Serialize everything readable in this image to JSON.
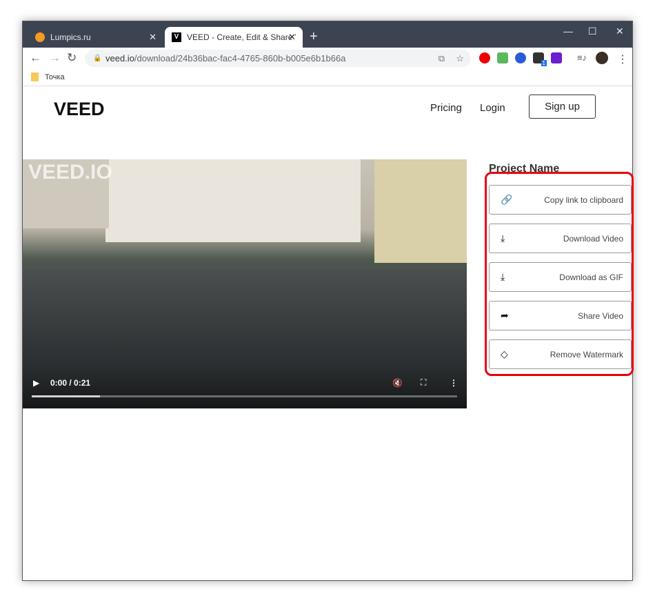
{
  "browser": {
    "tabs": [
      {
        "label": "Lumpics.ru",
        "favicon_color": "#f59a23"
      },
      {
        "label": "VEED - Create, Edit & Share Vide",
        "favicon": "V"
      }
    ],
    "url_host": "veed.io",
    "url_path": "/download/24b36bac-fac4-4765-860b-b005e6b1b66a",
    "bookmarks": [
      "Точка"
    ],
    "extension_badge": "1"
  },
  "site": {
    "logo": "VEED",
    "nav": [
      "Pricing",
      "Login"
    ],
    "signup": "Sign up"
  },
  "video": {
    "watermark": "VEED.IO",
    "time": "0:00 / 0:21",
    "progress_buffered": 0.16
  },
  "panel": {
    "title": "Project Name",
    "actions": [
      {
        "label": "Copy link to clipboard",
        "icon": "link-icon"
      },
      {
        "label": "Download Video",
        "icon": "download-icon"
      },
      {
        "label": "Download as GIF",
        "icon": "download-icon"
      },
      {
        "label": "Share Video",
        "icon": "share-icon"
      },
      {
        "label": "Remove Watermark",
        "icon": "diamond-icon"
      }
    ]
  },
  "colors": {
    "highlight": "#e8000f",
    "tabbar": "#3c4452"
  }
}
